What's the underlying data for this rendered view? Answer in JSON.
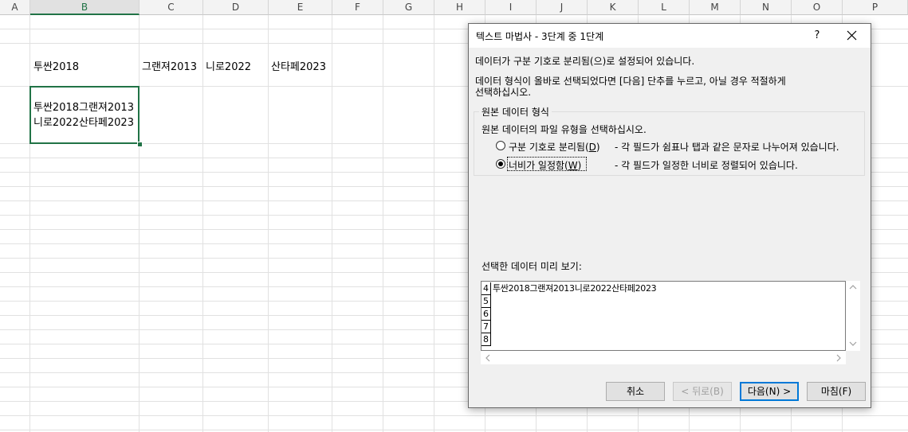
{
  "sheet": {
    "columns": [
      "A",
      "B",
      "C",
      "D",
      "E",
      "F",
      "G",
      "H",
      "I",
      "J",
      "K",
      "L",
      "M",
      "N",
      "O",
      "P"
    ],
    "selected_column": "B",
    "cells": {
      "b_row3": "투싼2018",
      "c_row3": "그랜져2013",
      "d_row3": "니로2022",
      "e_row3": "산타페2023",
      "b_active_line1": "투싼2018그랜져2013",
      "b_active_line2": "니로2022산타페2023"
    }
  },
  "dialog": {
    "title": "텍스트 마법사 - 3단계 중 1단계",
    "help": "?",
    "line1": "데이터가 구분 기호로 분리됨(으)로 설정되어 있습니다.",
    "line2a": "데이터 형식이 올바로 선택되었다면 [다음] 단추를 누르고, 아닐 경우 적절하게",
    "line2b": "선택하십시오.",
    "group_label": "원본 데이터 형식",
    "group_prompt": "원본 데이터의 파일 유형을 선택하십시오.",
    "option_delimited": {
      "label": "구분 기호로 분리됨(",
      "key": "D",
      "suffix": ")",
      "desc": "- 각 필드가 쉼표나 탭과 같은 문자로 나누어져 있습니다.",
      "selected": false
    },
    "option_fixed": {
      "label": "너비가 일정함(",
      "key": "W",
      "suffix": ")",
      "desc": "- 각 필드가 일정한 너비로 정렬되어 있습니다.",
      "selected": true
    },
    "preview_label": "선택한 데이터 미리 보기:",
    "preview_rows": [
      {
        "num": "4",
        "text": "투싼2018그랜져2013니로2022산타페2023"
      },
      {
        "num": "5",
        "text": ""
      },
      {
        "num": "6",
        "text": ""
      },
      {
        "num": "7",
        "text": ""
      },
      {
        "num": "8",
        "text": ""
      }
    ],
    "buttons": {
      "cancel": "취소",
      "back": "< 뒤로(B)",
      "next": "다음(N) >",
      "finish": "마침(F)"
    }
  }
}
